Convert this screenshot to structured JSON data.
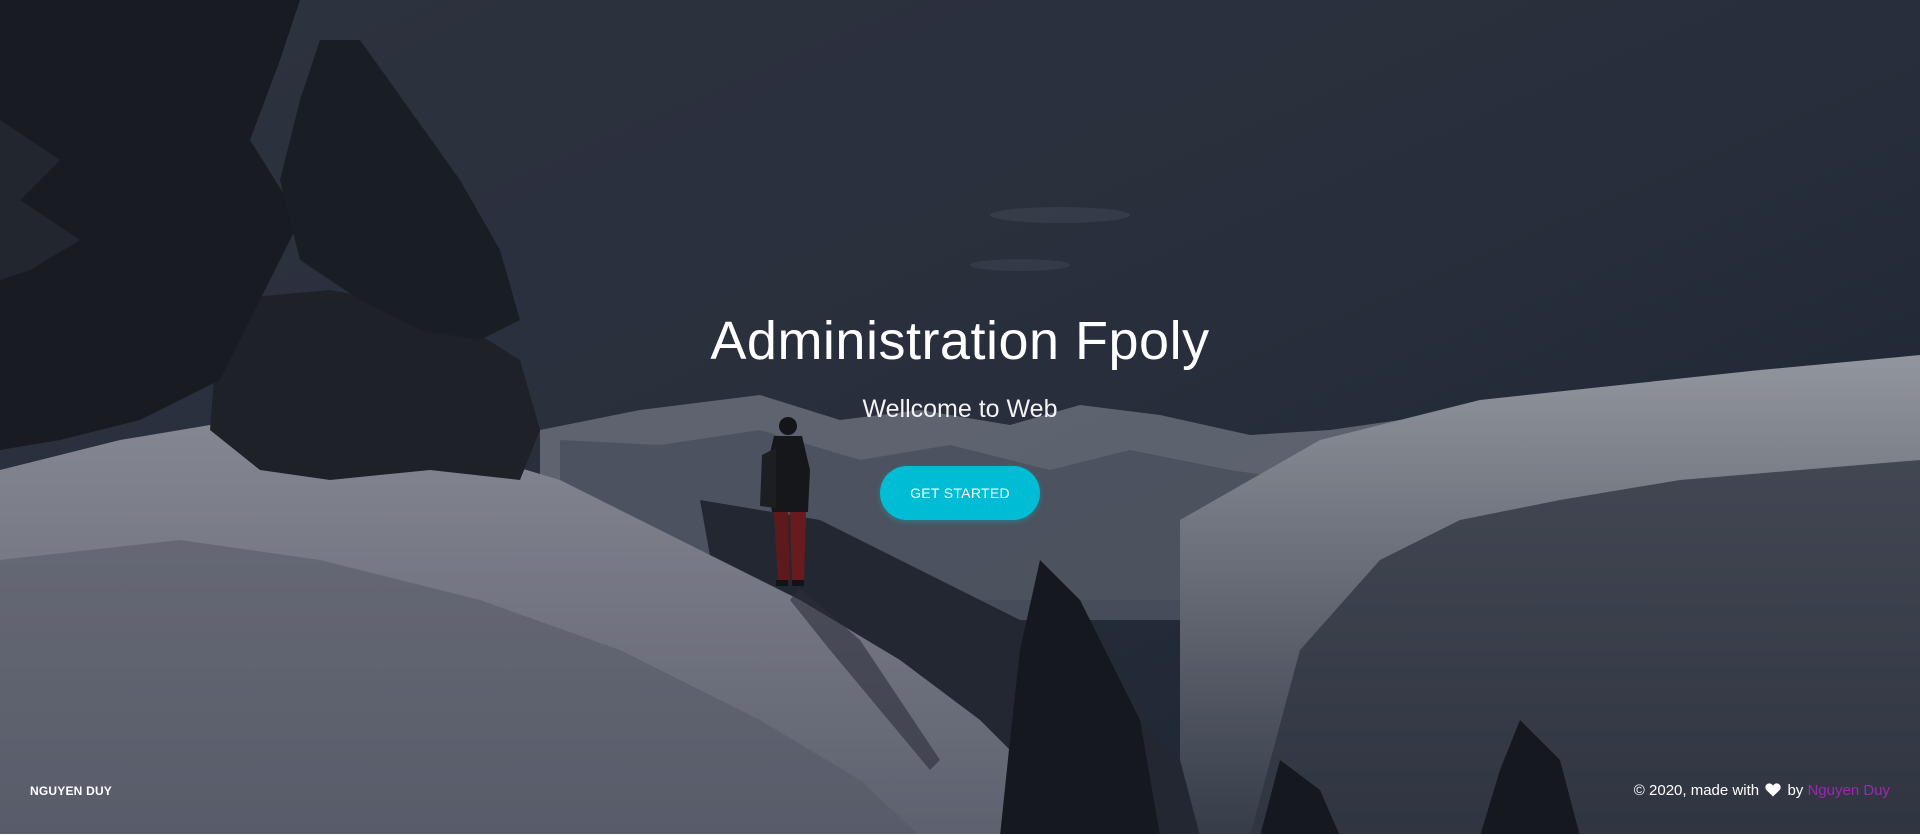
{
  "hero": {
    "title": "Administration Fpoly",
    "subtitle": "Wellcome to Web",
    "cta_label": "GET STARTED"
  },
  "footer": {
    "brand": "NGUYEN DUY",
    "copyright_prefix": "© 2020, made with",
    "copyright_by": "by",
    "author_name": "Nguyen Duy",
    "heart_icon": "heart-icon"
  },
  "colors": {
    "cta_button": "#00bcd4",
    "author_link": "#9c27b0",
    "text": "#ffffff"
  }
}
